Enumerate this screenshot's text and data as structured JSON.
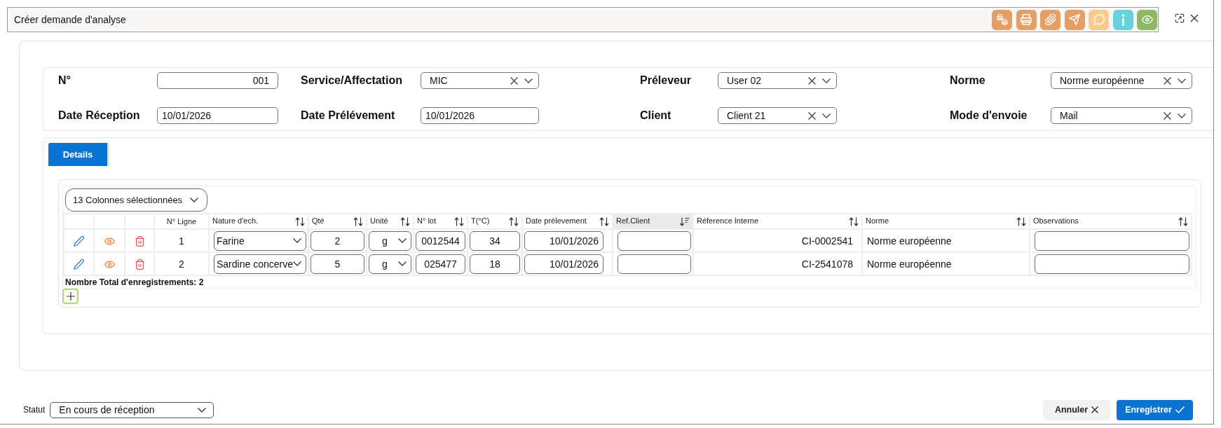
{
  "window": {
    "title": "Créer demande d'analyse"
  },
  "toolbar": [
    {
      "kind": "print-batch",
      "color": "#e59e66"
    },
    {
      "kind": "print",
      "color": "#e59e66"
    },
    {
      "kind": "attach",
      "color": "#e59e66"
    },
    {
      "kind": "send",
      "color": "#e59e66"
    },
    {
      "kind": "comment",
      "color": "#fdca8c"
    },
    {
      "kind": "info",
      "color": "#66d2dc"
    },
    {
      "kind": "preview",
      "color": "#8db865"
    }
  ],
  "header_fields": [
    {
      "label": "N°",
      "kind": "number",
      "value": "001"
    },
    {
      "label": "Service/Affectation",
      "kind": "select",
      "value": "MIC"
    },
    {
      "label": "Préleveur",
      "kind": "select",
      "value": "User 02"
    },
    {
      "label": "Norme",
      "kind": "select",
      "value": "Norme européenne"
    },
    {
      "label": "Date Réception",
      "kind": "date",
      "value": "10/01/2026"
    },
    {
      "label": "Date Prélévement",
      "kind": "date",
      "value": "10/01/2026"
    },
    {
      "label": "Client",
      "kind": "select",
      "value": "Client 21"
    },
    {
      "label": "Mode d'envoie",
      "kind": "select",
      "value": "Mail"
    }
  ],
  "tabs": [
    {
      "label": "Details",
      "selected": true
    }
  ],
  "table": {
    "column_picker": "13 Colonnes sélectionnées",
    "columns": [
      {
        "label": "N° Ligne",
        "sortable": false,
        "sorted": false
      },
      {
        "label": "Nature d'ech.",
        "sortable": true,
        "sorted": false
      },
      {
        "label": "Qté",
        "sortable": true,
        "sorted": false
      },
      {
        "label": "Unité",
        "sortable": true,
        "sorted": false
      },
      {
        "label": "N° lot",
        "sortable": true,
        "sorted": false
      },
      {
        "label": "T(°C)",
        "sortable": true,
        "sorted": false
      },
      {
        "label": "Date prélevement",
        "sortable": true,
        "sorted": false
      },
      {
        "label": "Ref.Client",
        "sortable": true,
        "sorted": true
      },
      {
        "label": "Réference Interne",
        "sortable": true,
        "sorted": false
      },
      {
        "label": "Norme",
        "sortable": true,
        "sorted": false
      },
      {
        "label": "Observations",
        "sortable": true,
        "sorted": false
      }
    ],
    "rows": [
      {
        "cells": [
          {
            "kind": "text",
            "value": "1"
          },
          {
            "kind": "select",
            "value": "Farine"
          },
          {
            "kind": "input",
            "value": "2"
          },
          {
            "kind": "select",
            "value": "g"
          },
          {
            "kind": "input",
            "value": "0012544"
          },
          {
            "kind": "input",
            "value": "34"
          },
          {
            "kind": "input",
            "value": "10/01/2026"
          },
          {
            "kind": "input"
          },
          {
            "kind": "text",
            "value": "CI-0002541"
          },
          {
            "kind": "text",
            "value": "Norme européenne"
          },
          {
            "kind": "input"
          }
        ]
      },
      {
        "cells": [
          {
            "kind": "text",
            "value": "2"
          },
          {
            "kind": "select",
            "value": "Sardine concerve"
          },
          {
            "kind": "input",
            "value": "5"
          },
          {
            "kind": "select",
            "value": "g"
          },
          {
            "kind": "input",
            "value": "025477"
          },
          {
            "kind": "input",
            "value": "18"
          },
          {
            "kind": "input",
            "value": "10/01/2026"
          },
          {
            "kind": "input"
          },
          {
            "kind": "text",
            "value": "CI-2541078"
          },
          {
            "kind": "text",
            "value": "Norme européenne"
          },
          {
            "kind": "input"
          }
        ]
      }
    ],
    "footer": "Nombre Total d'enregistrements: 2"
  },
  "status": {
    "label": "Statut",
    "value": "En cours de réception"
  },
  "buttons": [
    {
      "kind": "cancel",
      "label": "Annuler"
    },
    {
      "kind": "save",
      "label": "Enregistrer"
    }
  ]
}
